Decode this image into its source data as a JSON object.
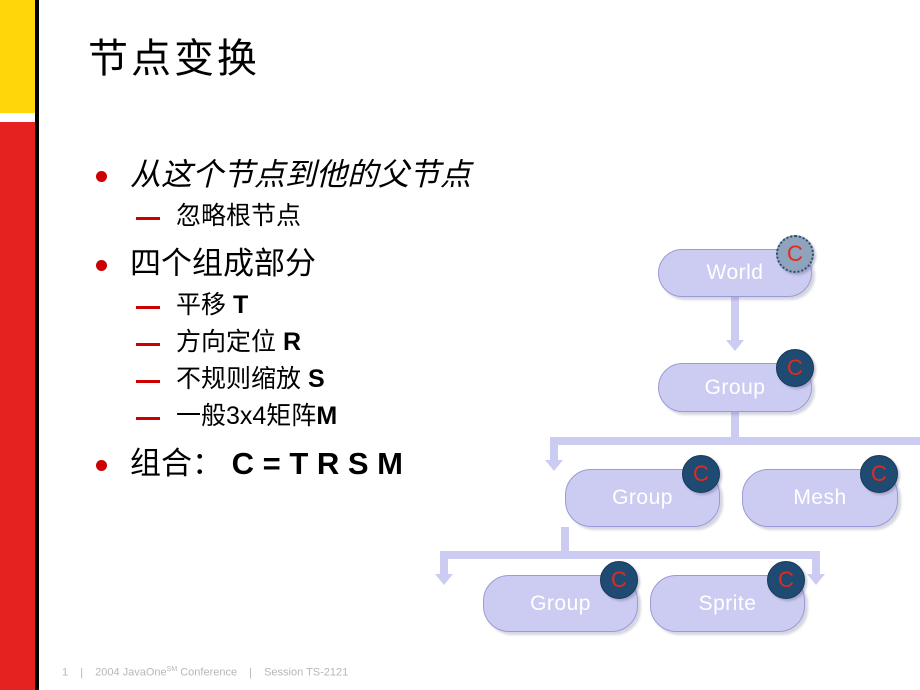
{
  "slide": {
    "title": "节点变换",
    "accent_yellow": "#ffd60a",
    "accent_red": "#e5221f",
    "bullet_color": "#cc0000"
  },
  "bullets": [
    {
      "level": 1,
      "text": "从这个节点到他的父节点",
      "italic": true
    },
    {
      "level": 2,
      "text": "忽略根节点"
    },
    {
      "level": 1,
      "text": "四个组成部分",
      "italic": false
    },
    {
      "level": 2,
      "text": "平移 ",
      "bold_tail": "T"
    },
    {
      "level": 2,
      "text": "方向定位 ",
      "bold_tail": "R"
    },
    {
      "level": 2,
      "text": "不规则缩放 ",
      "bold_tail": "S"
    },
    {
      "level": 2,
      "text": "一般3x4矩阵",
      "bold_tail": "M"
    },
    {
      "level": 1,
      "text": "组合：",
      "bold_tail": "  C = T R S M",
      "italic": false
    }
  ],
  "diagram": {
    "node_fill": "#ccccf2",
    "badge_fill": "#1f4a72",
    "badge_letter_color": "#e02b20",
    "nodes": [
      {
        "id": "world",
        "label": "World",
        "badge": "C",
        "selected": true
      },
      {
        "id": "group1",
        "label": "Group",
        "badge": "C",
        "selected": false
      },
      {
        "id": "group2",
        "label": "Group",
        "badge": "C",
        "selected": false
      },
      {
        "id": "mesh",
        "label": "Mesh",
        "badge": "C",
        "selected": false
      },
      {
        "id": "group3",
        "label": "Group",
        "badge": "C",
        "selected": false
      },
      {
        "id": "sprite",
        "label": "Sprite",
        "badge": "C",
        "selected": false
      }
    ]
  },
  "footer": {
    "page": "1",
    "conference": "2004 JavaOne",
    "conference_sup": "SM",
    "conference_tail": " Conference",
    "session": "Session TS-2121",
    "separator": "|"
  }
}
